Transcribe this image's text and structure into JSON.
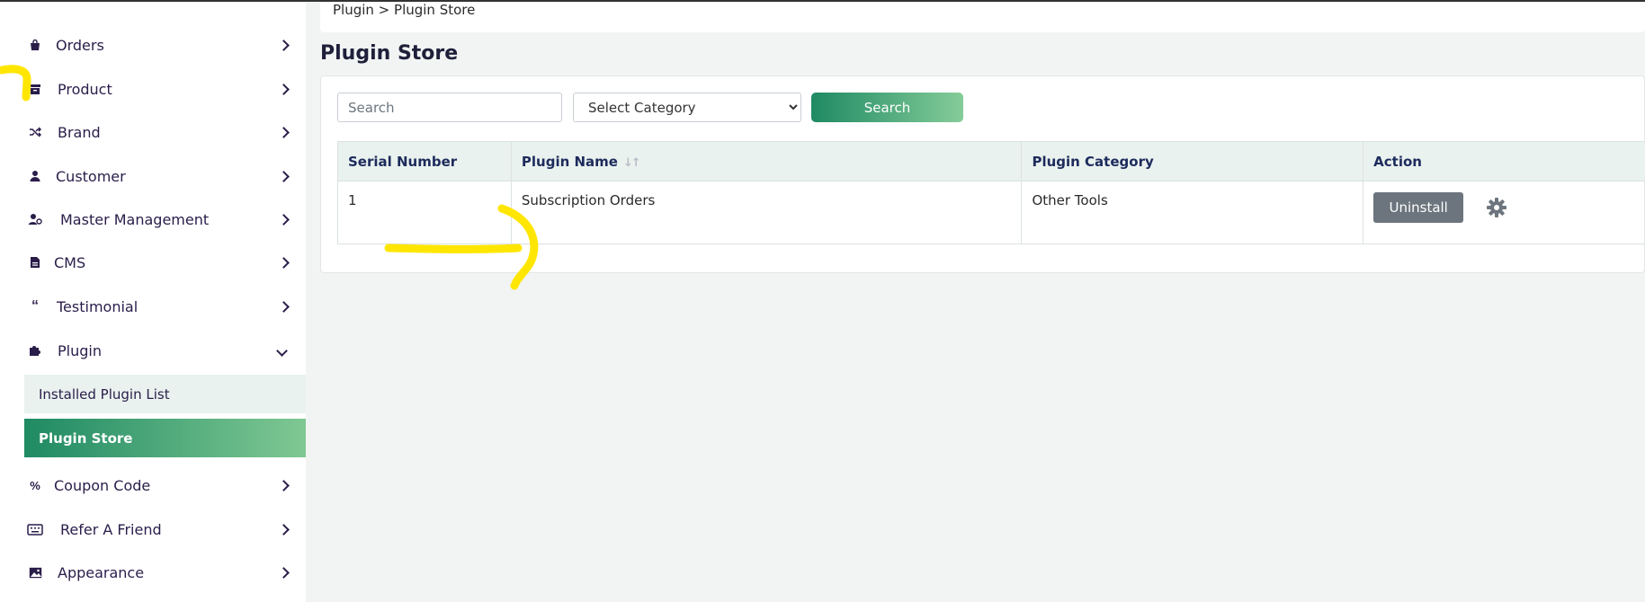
{
  "sidebar": {
    "items": [
      {
        "label": "Orders",
        "icon": "shopping-bag-icon"
      },
      {
        "label": "Product",
        "icon": "archive-box-icon"
      },
      {
        "label": "Brand",
        "icon": "shuffle-icon"
      },
      {
        "label": "Customer",
        "icon": "user-icon"
      },
      {
        "label": "Master Management",
        "icon": "user-gear-icon"
      },
      {
        "label": "CMS",
        "icon": "document-icon"
      },
      {
        "label": "Testimonial",
        "icon": "quote-icon"
      },
      {
        "label": "Plugin",
        "icon": "puzzle-icon"
      },
      {
        "label": "Coupon Code",
        "icon": "percent-icon"
      },
      {
        "label": "Refer A Friend",
        "icon": "keyboard-icon"
      },
      {
        "label": "Appearance",
        "icon": "image-icon"
      }
    ],
    "plugin_sub": {
      "installed": "Installed Plugin List",
      "store": "Plugin Store"
    }
  },
  "breadcrumb": "Plugin > Plugin Store",
  "page_title": "Plugin Store",
  "filters": {
    "search_placeholder": "Search",
    "category_placeholder": "Select Category",
    "search_button": "Search"
  },
  "table": {
    "headers": [
      "Serial Number",
      "Plugin Name",
      "Plugin Category",
      "Action"
    ],
    "rows": [
      {
        "serial": "1",
        "name": "Subscription Orders",
        "category": "Other Tools",
        "action": "Uninstall"
      }
    ]
  },
  "colors": {
    "accent_start": "#1f8a63",
    "accent_end": "#7fc893",
    "annotation": "#ffe600",
    "text": "#2a1d4a"
  }
}
